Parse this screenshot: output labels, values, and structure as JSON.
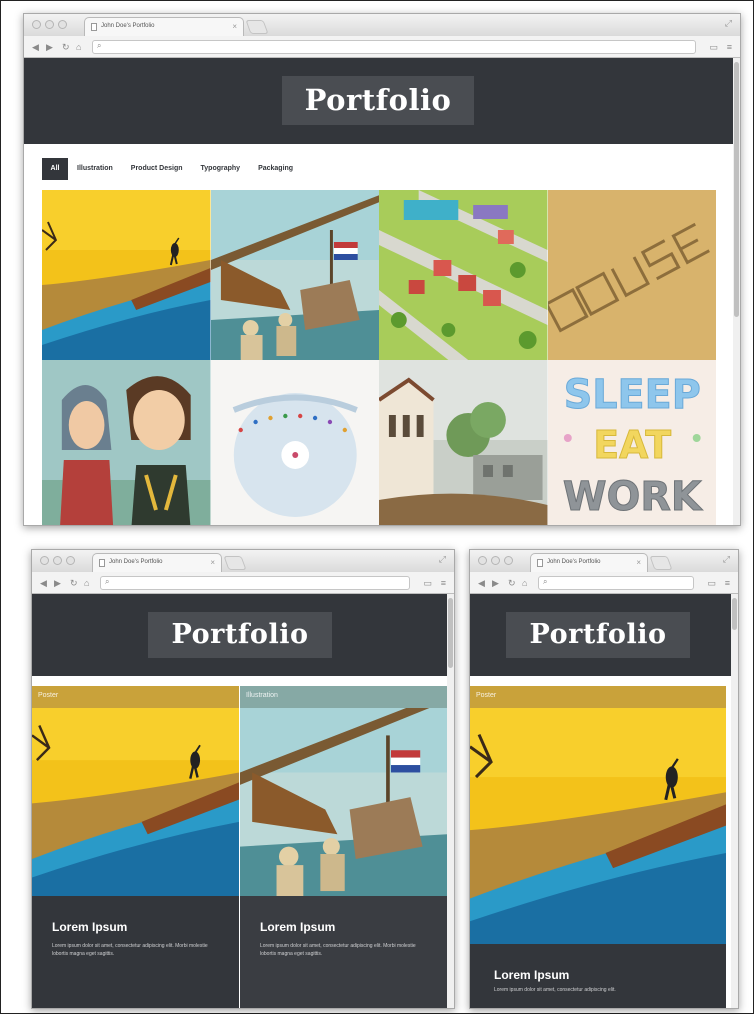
{
  "browser": {
    "tab_title": "John Doe's Portfolio",
    "tab_close": "×",
    "url": ""
  },
  "site": {
    "brand": "Portfolio"
  },
  "filters": [
    {
      "label": "All",
      "active": true
    },
    {
      "label": "Illustration",
      "active": false
    },
    {
      "label": "Product Design",
      "active": false
    },
    {
      "label": "Typography",
      "active": false
    },
    {
      "label": "Packaging",
      "active": false
    }
  ],
  "grid": [
    {
      "name": "stork-illustration",
      "subject": "stork on a tree branch over a yellow sky"
    },
    {
      "name": "sailors-illustration",
      "subject": "sailors rowing beside a tall ship"
    },
    {
      "name": "city-map-illustration",
      "subject": "isometric city map"
    },
    {
      "name": "house-typography",
      "subject": "hand drawn HOUSE lettering on kraft paper"
    },
    {
      "name": "characters-illustration",
      "subject": "two cartoon characters"
    },
    {
      "name": "record-packaging",
      "subject": "round record packaging with colored dots"
    },
    {
      "name": "street-illustration",
      "subject": "old street with buildings and trees"
    },
    {
      "name": "sleep-eat-work-typography",
      "text": [
        "SLEEP",
        "EAT",
        "WORK"
      ]
    }
  ],
  "cards": [
    {
      "category": "Poster",
      "title": "Lorem Ipsum",
      "text": "Lorem ipsum dolor sit amet, consectetur adipiscing elit. Morbi molestie lobortis magna eget sagittis."
    },
    {
      "category": "Illustration",
      "title": "Lorem Ipsum",
      "text": "Lorem ipsum dolor sit amet, consectetur adipiscing elit. Morbi molestie lobortis magna eget sagittis."
    },
    {
      "category": "Poster",
      "title": "Lorem Ipsum",
      "text": "Lorem ipsum dolor sit amet, consectetur adipiscing elit."
    }
  ],
  "colors": {
    "header": "#33363b",
    "brand_box": "#4a4d52",
    "accent_yellow": "#f1bf1a"
  }
}
